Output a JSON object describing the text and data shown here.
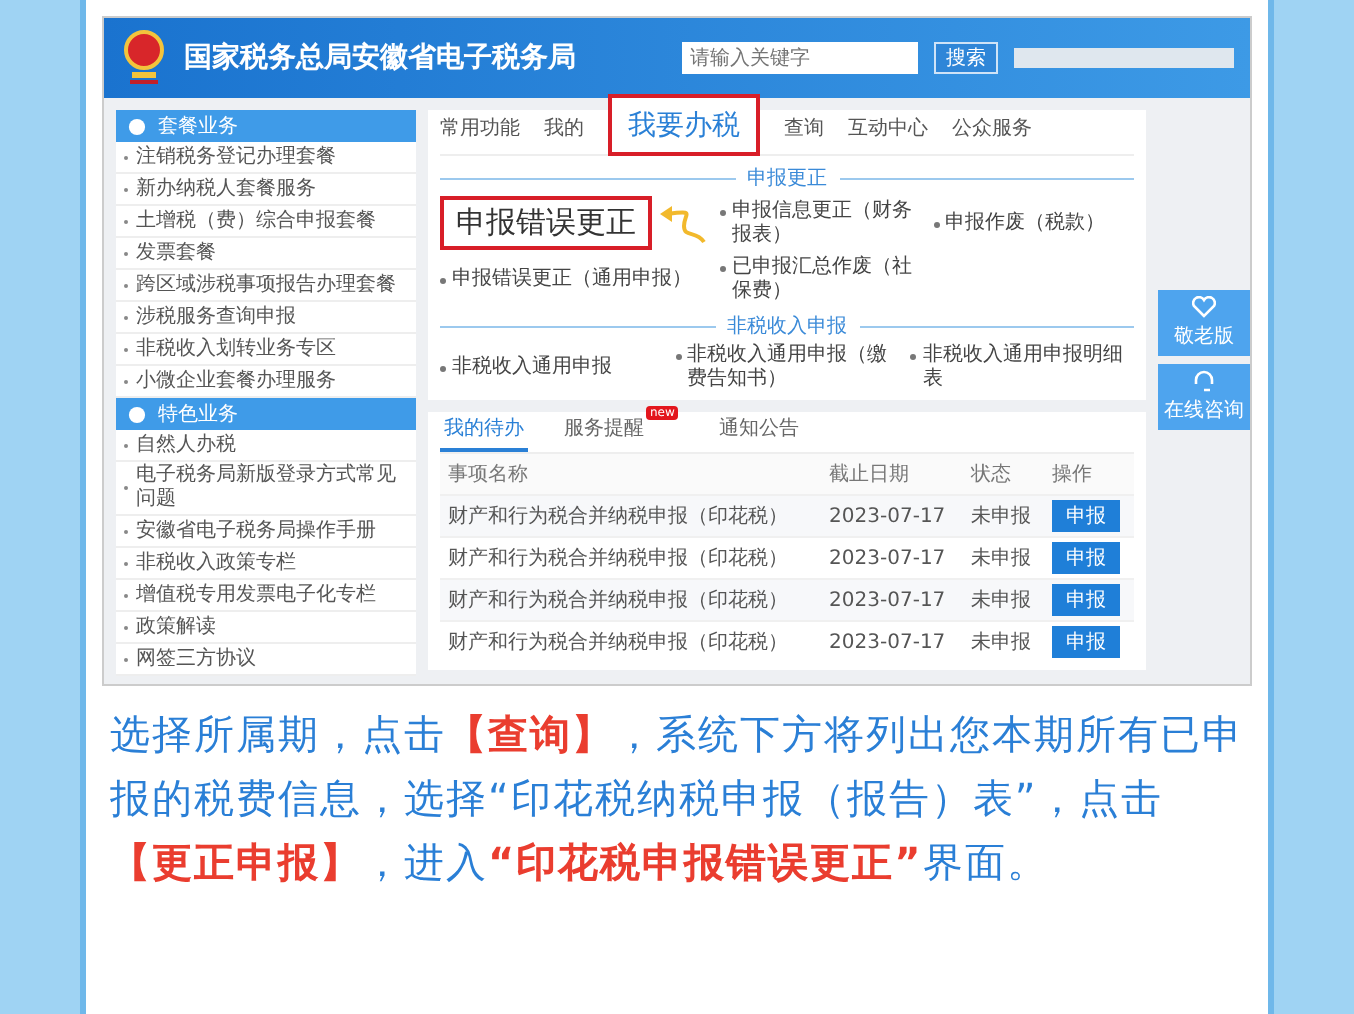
{
  "header": {
    "site_title": "国家税务总局安徽省电子税务局",
    "search": {
      "placeholder": "请输入关键字"
    },
    "search_button": "搜索"
  },
  "sidebar": {
    "groups": [
      {
        "title": "套餐业务",
        "items": [
          "注销税务登记办理套餐",
          "新办纳税人套餐服务",
          "土增税（费）综合申报套餐",
          "发票套餐",
          "跨区域涉税事项报告办理套餐",
          "涉税服务查询申报",
          "非税收入划转业务专区",
          "小微企业套餐办理服务"
        ]
      },
      {
        "title": "特色业务",
        "items": [
          "自然人办税",
          "电子税务局新版登录方式常见问题",
          "安徽省电子税务局操作手册",
          "非税收入政策专栏",
          "增值税专用发票电子化专栏",
          "政策解读",
          "网签三方协议"
        ]
      }
    ]
  },
  "nav": {
    "tabs": [
      {
        "label": "常用功能",
        "kind": "tab"
      },
      {
        "label": "我的",
        "kind": "tab"
      },
      {
        "label": "我要办税",
        "kind": "callout"
      },
      {
        "label": "查询",
        "kind": "tab"
      },
      {
        "label": "互动中心",
        "kind": "tab"
      },
      {
        "label": "公众服务",
        "kind": "tab"
      }
    ]
  },
  "sections": [
    {
      "title": "申报更正",
      "items": [
        {
          "label": "申报错误更正",
          "kind": "callout"
        },
        {
          "label": "申报信息更正（财务报表）",
          "kind": "link"
        },
        {
          "label": "申报作废（税款）",
          "kind": "link"
        },
        {
          "label": "申报错误更正（通用申报）",
          "kind": "link"
        },
        {
          "label": "已申报汇总作废（社保费）",
          "kind": "link"
        }
      ]
    },
    {
      "title": "非税收入申报",
      "items": [
        {
          "label": "非税收入通用申报",
          "kind": "link"
        },
        {
          "label": "非税收入通用申报（缴费告知书）",
          "kind": "link"
        },
        {
          "label": "非税收入通用申报明细表",
          "kind": "link"
        }
      ]
    }
  ],
  "float_buttons": [
    {
      "label": "敬老版",
      "kind": "heart"
    },
    {
      "label": "在线咨询",
      "kind": "headset"
    }
  ],
  "todo": {
    "tabs": [
      {
        "label": "我的待办",
        "selected": true
      },
      {
        "label": "服务提醒",
        "selected": false,
        "badge": "new"
      },
      {
        "label": "通知公告",
        "selected": false
      }
    ],
    "columns": [
      "事项名称",
      "截止日期",
      "状态",
      "操作"
    ],
    "rows": [
      {
        "name": "财产和行为税合并纳税申报（印花税）",
        "deadline": "2023-07-17",
        "status": "未申报",
        "action": "申报"
      },
      {
        "name": "财产和行为税合并纳税申报（印花税）",
        "deadline": "2023-07-17",
        "status": "未申报",
        "action": "申报"
      },
      {
        "name": "财产和行为税合并纳税申报（印花税）",
        "deadline": "2023-07-17",
        "status": "未申报",
        "action": "申报"
      },
      {
        "name": "财产和行为税合并纳税申报（印花税）",
        "deadline": "2023-07-17",
        "status": "未申报",
        "action": "申报"
      }
    ]
  },
  "caption": "选择所属期，点击**【查询】**，系统下方将列出您本期所有已申报的税费信息，选择“印花税纳税申报（报告）表”，点击**【更正申报】**，进入**“印花税申报错误更正”**界面。"
}
